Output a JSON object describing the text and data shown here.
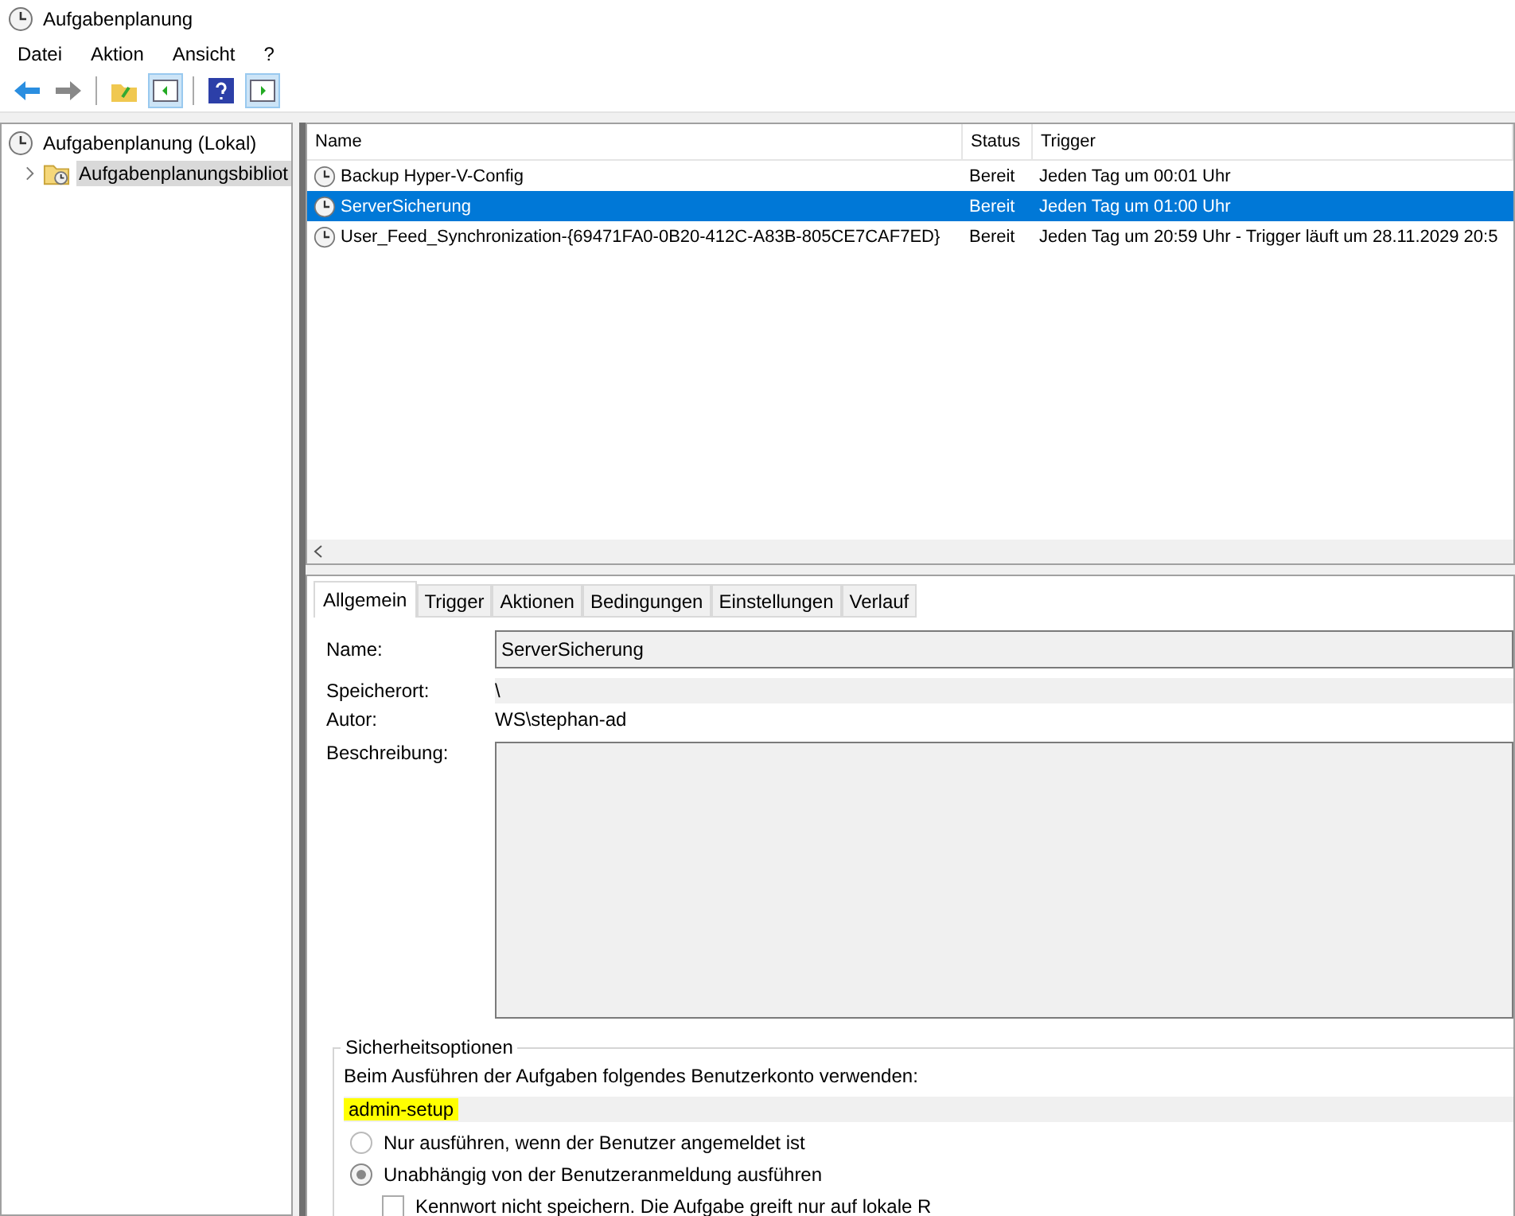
{
  "window": {
    "title": "Aufgabenplanung"
  },
  "menu": [
    "Datei",
    "Aktion",
    "Ansicht",
    "?"
  ],
  "tree": [
    {
      "label": "Aufgabenplanung (Lokal)",
      "selected": false,
      "children": [
        {
          "label": "Aufgabenplanungsbibliot",
          "selected": true,
          "expanded": false
        }
      ]
    }
  ],
  "table": {
    "columns": [
      "Name",
      "Status",
      "Trigger"
    ],
    "rows": [
      {
        "name": "Backup Hyper-V-Config",
        "status": "Bereit",
        "trigger": "Jeden Tag um 00:01 Uhr",
        "selected": false
      },
      {
        "name": "ServerSicherung",
        "status": "Bereit",
        "trigger": "Jeden Tag um 01:00 Uhr",
        "selected": true
      },
      {
        "name": "User_Feed_Synchronization-{69471FA0-0B20-412C-A83B-805CE7CAF7ED}",
        "status": "Bereit",
        "trigger": "Jeden Tag um 20:59 Uhr - Trigger läuft um 28.11.2029 20:5",
        "selected": false
      }
    ]
  },
  "tabs": [
    {
      "label": "Allgemein",
      "selected": true
    },
    {
      "label": "Trigger",
      "selected": false
    },
    {
      "label": "Aktionen",
      "selected": false
    },
    {
      "label": "Bedingungen",
      "selected": false
    },
    {
      "label": "Einstellungen",
      "selected": false
    },
    {
      "label": "Verlauf",
      "selected": false
    }
  ],
  "general": {
    "name_label": "Name:",
    "name_value": "ServerSicherung",
    "location_label": "Speicherort:",
    "location_value": "\\",
    "author_label": "Autor:",
    "author_value": "WS\\stephan-ad",
    "description_label": "Beschreibung:"
  },
  "security": {
    "title": "Sicherheitsoptionen",
    "account_label": "Beim Ausführen der Aufgaben folgendes Benutzerkonto verwenden:",
    "account_value": "admin-setup",
    "options": [
      {
        "kind": "radio",
        "label": "Nur ausführen, wenn der Benutzer angemeldet ist",
        "selected": false
      },
      {
        "kind": "radio",
        "label": "Unabhängig von der Benutzeranmeldung ausführen",
        "selected": true
      },
      {
        "kind": "checkbox",
        "label": "Kennwort nicht speichern. Die Aufgabe greift nur auf lokale R",
        "checked": false
      }
    ]
  }
}
